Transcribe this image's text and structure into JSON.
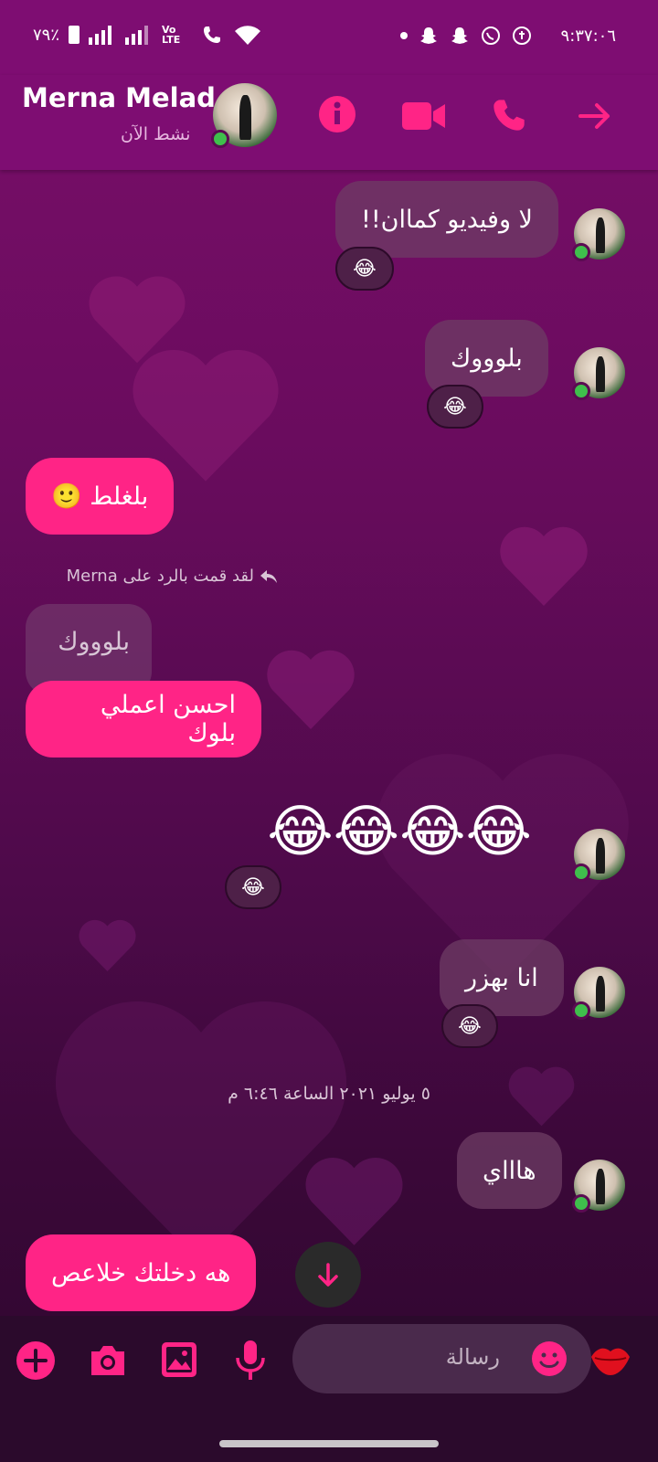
{
  "statusbar": {
    "battery": "٧٩٪",
    "time": "٩:٣٧:٠٦",
    "volte": "Vo LTE"
  },
  "header": {
    "name": "Merna Melad",
    "status": "نشط الآن"
  },
  "messages": {
    "m1": "لا وفيديو كماان!!",
    "m1_react": "😂",
    "m2": "بلوووك",
    "m2_react": "😂",
    "m3": "بلغلط 🙂",
    "reply_meta": "لقد قمت بالرد على Merna",
    "quoted": "بلوووك",
    "m4": "احسن  اعملي  بلوك",
    "m5": "😂😂😂😂",
    "m5_react": "😂",
    "m6": "انا بهزر",
    "m6_react": "😂",
    "date": "٥ يوليو ٢٠٢١ الساعة ٦:٤٦ م",
    "m7": "هاااي",
    "m8": "هه دخلتك خلاعص"
  },
  "composer": {
    "placeholder": "رسالة"
  },
  "colors": {
    "accent": "#ff2486",
    "header": "#7e0d72",
    "bottom": "#2b0a2c"
  },
  "icons": [
    "info-icon",
    "video-call-icon",
    "phone-icon",
    "forward-arrow-icon",
    "plus-icon",
    "camera-icon",
    "gallery-icon",
    "microphone-icon",
    "emoji-icon",
    "kiss-icon",
    "scroll-down-icon"
  ]
}
